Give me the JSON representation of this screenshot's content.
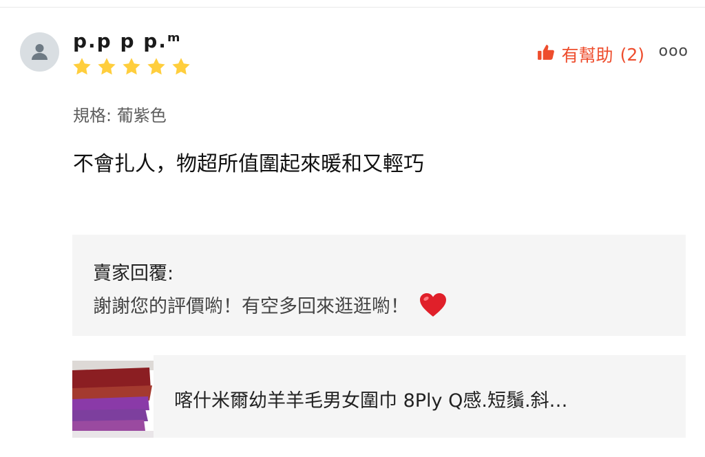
{
  "review": {
    "username": "p.p p p.ᵐ",
    "rating": 5,
    "variation": "規格: 葡紫色",
    "comment": "不會扎人，物超所值圍起來暖和又輕巧",
    "helpful_label": "有幫助",
    "helpful_count": "2",
    "more_label": "ooo"
  },
  "seller_reply": {
    "title": "賣家回覆:",
    "text": "謝謝您的評價喲！有空多回來逛逛喲！"
  },
  "product": {
    "name": "喀什米爾幼羊羊毛男女圍巾 8Ply Q感.短鬚.斜…"
  },
  "colors": {
    "accent": "#ee4d2d",
    "star": "#ffce3d",
    "panel": "#f5f5f5",
    "heart": "#e0202a"
  },
  "icons": [
    "user-icon",
    "star-icon",
    "thumbs-up-icon",
    "more-icon",
    "heart-icon"
  ]
}
